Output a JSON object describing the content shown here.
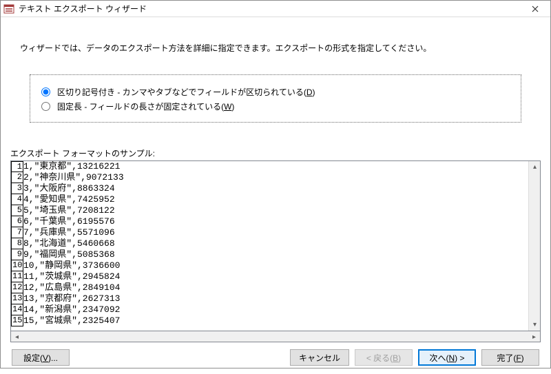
{
  "title": "テキスト エクスポート ウィザード",
  "intro": "ウィザードでは、データのエクスポート方法を詳細に指定できます。エクスポートの形式を指定してください。",
  "radios": {
    "delimited_label_pre": "区切り記号付き - カンマやタブなどでフィールドが区切られている(",
    "delimited_hotkey": "D",
    "delimited_label_post": ")",
    "fixed_label_pre": "固定長 - フィールドの長さが固定されている(",
    "fixed_hotkey": "W",
    "fixed_label_post": ")",
    "selected": "delimited"
  },
  "sample_label": "エクスポート フォーマットのサンプル:",
  "sample_rows": [
    {
      "n": "1",
      "txt": "1,\"東京都\",13216221"
    },
    {
      "n": "2",
      "txt": "2,\"神奈川県\",9072133"
    },
    {
      "n": "3",
      "txt": "3,\"大阪府\",8863324"
    },
    {
      "n": "4",
      "txt": "4,\"愛知県\",7425952"
    },
    {
      "n": "5",
      "txt": "5,\"埼玉県\",7208122"
    },
    {
      "n": "6",
      "txt": "6,\"千葉県\",6195576"
    },
    {
      "n": "7",
      "txt": "7,\"兵庫県\",5571096"
    },
    {
      "n": "8",
      "txt": "8,\"北海道\",5460668"
    },
    {
      "n": "9",
      "txt": "9,\"福岡県\",5085368"
    },
    {
      "n": "10",
      "txt": "10,\"静岡県\",3736600"
    },
    {
      "n": "11",
      "txt": "11,\"茨城県\",2945824"
    },
    {
      "n": "12",
      "txt": "12,\"広島県\",2849104"
    },
    {
      "n": "13",
      "txt": "13,\"京都府\",2627313"
    },
    {
      "n": "14",
      "txt": "14,\"新潟県\",2347092"
    },
    {
      "n": "15",
      "txt": "15,\"宮城県\",2325407"
    }
  ],
  "buttons": {
    "advanced_pre": "設定(",
    "advanced_hot": "V",
    "advanced_post": ")...",
    "cancel": "キャンセル",
    "back_pre": "< 戻る(",
    "back_hot": "B",
    "back_post": ")",
    "next_pre": "次へ(",
    "next_hot": "N",
    "next_post": ") >",
    "finish_pre": "完了(",
    "finish_hot": "F",
    "finish_post": ")"
  }
}
